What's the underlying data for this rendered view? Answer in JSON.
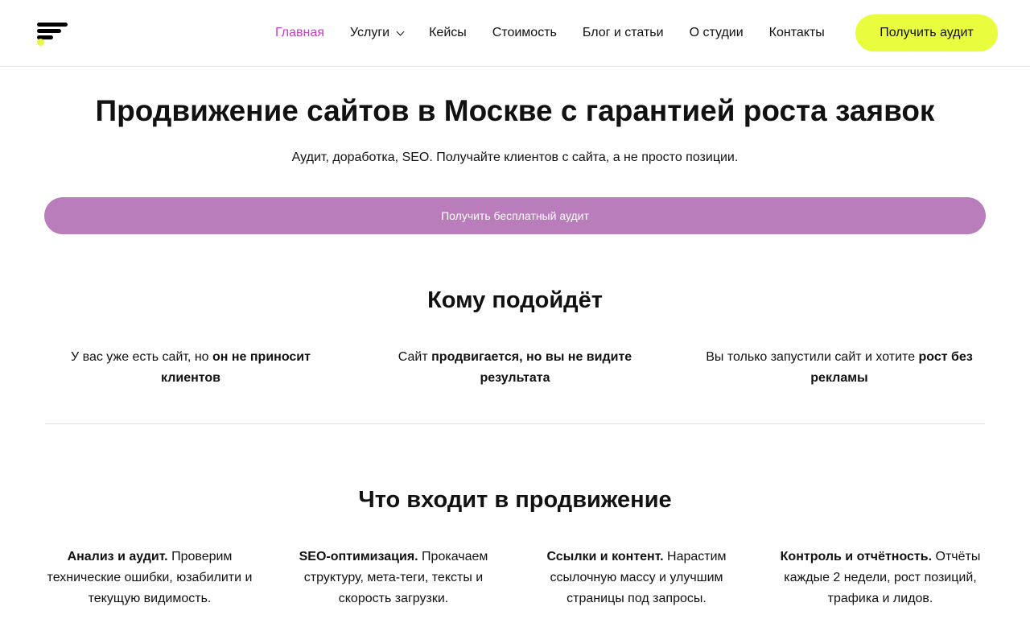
{
  "header": {
    "nav": [
      {
        "label": "Главная",
        "active": true
      },
      {
        "label": "Услуги",
        "has_dropdown": true
      },
      {
        "label": "Кейсы"
      },
      {
        "label": "Стоимость"
      },
      {
        "label": "Блог и статьи"
      },
      {
        "label": "О студии"
      },
      {
        "label": "Контакты"
      }
    ],
    "cta_label": "Получить аудит"
  },
  "hero": {
    "title": "Продвижение сайтов в Москве с гарантией роста заявок",
    "subtitle": "Аудит, доработка, SEO. Получайте клиентов с сайта, а не просто позиции.",
    "button_label": "Получить бесплатный аудит"
  },
  "who": {
    "title": "Кому подойдёт",
    "items": [
      {
        "text": "У вас уже есть сайт, но ",
        "bold": "он не приносит клиентов",
        "after": ""
      },
      {
        "text": "Сайт ",
        "bold": "продвигается, но вы не видите результата",
        "after": ""
      },
      {
        "text": "Вы только запустили сайт и хотите ",
        "bold": "рост без рекламы",
        "after": ""
      }
    ]
  },
  "what": {
    "title": "Что входит в продвижение",
    "items": [
      {
        "bold": "Анализ и аудит.",
        "text": " Проверим технические ошибки, юзабилити и текущую видимость."
      },
      {
        "bold": "SEO-оптимизация.",
        "text": " Прокачаем структуру, мета-теги, тексты и скорость загрузки."
      },
      {
        "bold": "Ссылки и контент.",
        "text": " Нарастим ссылочную массу и улучшим страницы под запросы."
      },
      {
        "bold": "Контроль и отчётность.",
        "text": " Отчёты каждые 2 недели, рост позиций, трафика и лидов."
      }
    ]
  },
  "colors": {
    "accent_nav": "#c23fc2",
    "cta_yellow": "#eafc3e",
    "hero_button": "#b97dbb"
  }
}
